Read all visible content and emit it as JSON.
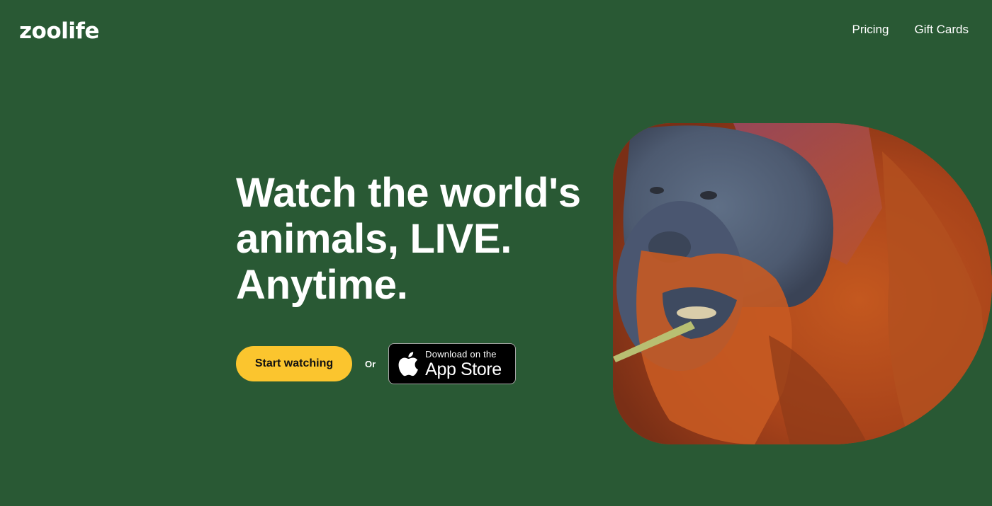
{
  "header": {
    "logo": "zoolife",
    "nav": [
      {
        "label": "Pricing"
      },
      {
        "label": "Gift Cards"
      }
    ]
  },
  "hero": {
    "headline": "Watch the world's animals, LIVE. Anytime.",
    "start_button": "Start watching",
    "or_text": "Or",
    "appstore": {
      "small": "Download on the",
      "big": "App Store",
      "icon": "apple-icon"
    },
    "image": {
      "subject": "orangutan-photo"
    }
  },
  "colors": {
    "background": "#295934",
    "accent": "#fbc52e",
    "text": "#ffffff",
    "appstore_bg": "#000000"
  }
}
